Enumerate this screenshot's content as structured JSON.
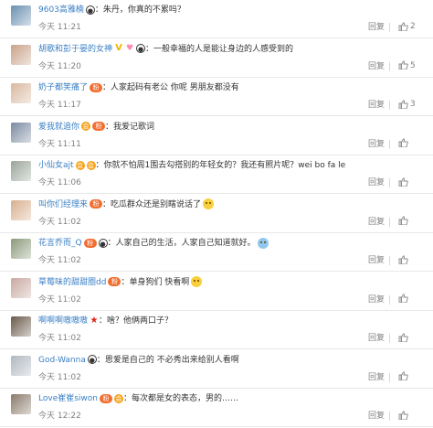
{
  "labels": {
    "reply": "回复"
  },
  "colors": {
    "username": "#3a7fc4",
    "meta": "#808080",
    "divider": "#e8e8e8"
  },
  "comments": [
    {
      "username": "9603高雅楠",
      "badges": [
        "panda"
      ],
      "text": "：朱丹，你真的不累吗？",
      "time": "今天 11:21",
      "likes": "2",
      "avatar_color": "#6a8fb0",
      "emoji": ""
    },
    {
      "username": "胡歌和彭于晏的女神",
      "badges": [
        "v",
        "bow",
        "panda"
      ],
      "text": "：一般幸福的人是能让身边的人感受到的",
      "time": "今天 11:20",
      "likes": "5",
      "avatar_color": "#c9a38a",
      "emoji": ""
    },
    {
      "username": "奶子都笑痛了",
      "badges": [
        "fan"
      ],
      "text": "：人家起码有老公 你呢 男朋友都没有⁡",
      "time": "今天 11:17",
      "likes": "3",
      "avatar_color": "#d9b8a0",
      "emoji": ""
    },
    {
      "username": "爱我就追你",
      "badges": [
        "member",
        "fan"
      ],
      "text": "：我爱记歌词",
      "time": "今天 11:11",
      "likes": "",
      "avatar_color": "#7a8aa0",
      "emoji": ""
    },
    {
      "username": "小仙女ajt",
      "badges": [
        "member",
        "member"
      ],
      "text": "：你就不怕周1围去勾搭别的年轻女的？我还有照片呢？wei bo fa le",
      "time": "今天 11:06",
      "likes": "",
      "avatar_color": "#9aa59a",
      "emoji": ""
    },
    {
      "username": "叫你们经理来",
      "badges": [
        "fan"
      ],
      "text": "：吃瓜群众还是别瞎说话了",
      "time": "今天 11:02",
      "likes": "",
      "avatar_color": "#d8b090",
      "emoji": "yellow"
    },
    {
      "username": "花言乔而_Q",
      "badges": [
        "fan",
        "panda"
      ],
      "text": "：人家自己的生活，人家自己知道就好。",
      "time": "今天 11:02",
      "likes": "",
      "avatar_color": "#8a9a7a",
      "emoji": "blue"
    },
    {
      "username": "草莓味的甜甜圈dd",
      "badges": [
        "fan"
      ],
      "text": "：单身狗们 快看啊",
      "time": "今天 11:02",
      "likes": "",
      "avatar_color": "#c8a8a0",
      "emoji": "yellow"
    },
    {
      "username": "啊啊啊嗷嗷嗷",
      "badges": [
        "star"
      ],
      "text": "：啥？他俩两口子？",
      "time": "今天 11:02",
      "likes": "",
      "avatar_color": "#6a5a4a",
      "emoji": ""
    },
    {
      "username": "God-Wanna",
      "badges": [
        "panda"
      ],
      "text": "：恩爱是自己的 不必秀出来给别人看啊",
      "time": "今天 11:02",
      "likes": "",
      "avatar_color": "#b0b8c0",
      "emoji": ""
    },
    {
      "username": "Love崔崔siwon",
      "badges": [
        "fan",
        "member"
      ],
      "text": "：每次都是女的表态，男的……",
      "time": "今天 12:22",
      "likes": "",
      "avatar_color": "#8a7a6a",
      "emoji": ""
    }
  ]
}
